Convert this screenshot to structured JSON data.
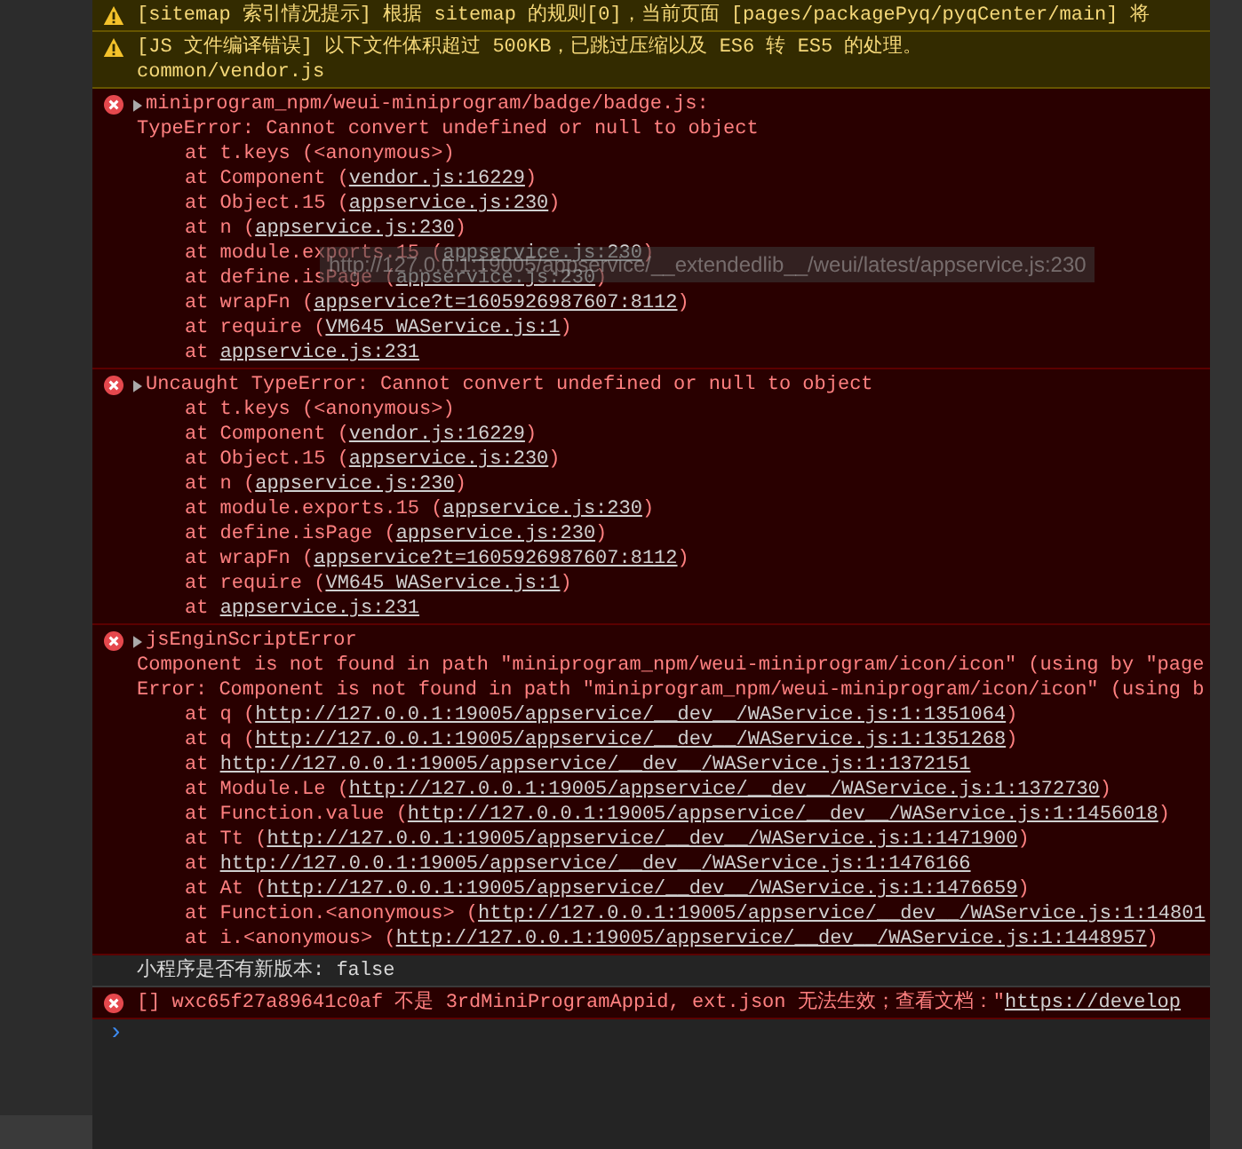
{
  "messages": [
    {
      "kind": "warning",
      "lines": [
        {
          "kind": "text",
          "text": "[sitemap 索引情况提示] 根据 sitemap 的规则[0]，当前页面 [pages/packagePyq/pyqCenter/main] 将"
        }
      ]
    },
    {
      "kind": "warning",
      "lines": [
        {
          "kind": "text",
          "text": "[JS 文件编译错误] 以下文件体积超过 500KB，已跳过压缩以及 ES6 转 ES5 的处理。"
        },
        {
          "kind": "text",
          "text": "common/vendor.js"
        }
      ]
    },
    {
      "kind": "error",
      "expandable": true,
      "lines": [
        {
          "kind": "text",
          "text": "miniprogram_npm/weui-miniprogram/badge/badge.js:"
        },
        {
          "kind": "text",
          "text": "TypeError: Cannot convert undefined or null to object"
        },
        {
          "kind": "frame",
          "text": "at t.keys (<anonymous>)"
        },
        {
          "kind": "frame",
          "text": "at Component (",
          "link": "vendor.js:16229",
          "after": ")"
        },
        {
          "kind": "frame",
          "text": "at Object.15 (",
          "link": "appservice.js:230",
          "after": ")"
        },
        {
          "kind": "frame",
          "text": "at n (",
          "link": "appservice.js:230",
          "after": ")"
        },
        {
          "kind": "frame",
          "text": "at module.exports.15 (",
          "link": "appservice.js:230",
          "after": ")"
        },
        {
          "kind": "frame",
          "text": "at define.isPage (",
          "link": "appservice.js:230",
          "after": ")"
        },
        {
          "kind": "frame",
          "text": "at wrapFn (",
          "link": "appservice?t=1605926987607:8112",
          "after": ")"
        },
        {
          "kind": "frame",
          "text": "at require (",
          "link": "VM645 WAService.js:1",
          "after": ")"
        },
        {
          "kind": "frame",
          "text": "at ",
          "link": "appservice.js:231"
        }
      ]
    },
    {
      "kind": "error",
      "expandable": true,
      "lines": [
        {
          "kind": "text",
          "text": "Uncaught TypeError: Cannot convert undefined or null to object"
        },
        {
          "kind": "frame",
          "text": "at t.keys (<anonymous>)"
        },
        {
          "kind": "frame",
          "text": "at Component (",
          "link": "vendor.js:16229",
          "after": ")"
        },
        {
          "kind": "frame",
          "text": "at Object.15 (",
          "link": "appservice.js:230",
          "after": ")"
        },
        {
          "kind": "frame",
          "text": "at n (",
          "link": "appservice.js:230",
          "after": ")"
        },
        {
          "kind": "frame",
          "text": "at module.exports.15 (",
          "link": "appservice.js:230",
          "after": ")"
        },
        {
          "kind": "frame",
          "text": "at define.isPage (",
          "link": "appservice.js:230",
          "after": ")"
        },
        {
          "kind": "frame",
          "text": "at wrapFn (",
          "link": "appservice?t=1605926987607:8112",
          "after": ")"
        },
        {
          "kind": "frame",
          "text": "at require (",
          "link": "VM645 WAService.js:1",
          "after": ")"
        },
        {
          "kind": "frame",
          "text": "at ",
          "link": "appservice.js:231"
        }
      ]
    },
    {
      "kind": "error",
      "expandable": true,
      "lines": [
        {
          "kind": "text",
          "text": "jsEnginScriptError"
        },
        {
          "kind": "text",
          "text": "Component is not found in path \"miniprogram_npm/weui-miniprogram/icon/icon\" (using by \"page"
        },
        {
          "kind": "text",
          "text": "Error: Component is not found in path \"miniprogram_npm/weui-miniprogram/icon/icon\" (using b"
        },
        {
          "kind": "frame",
          "text": "at q (",
          "link": "http://127.0.0.1:19005/appservice/__dev__/WAService.js:1:1351064",
          "after": ")"
        },
        {
          "kind": "frame",
          "text": "at q (",
          "link": "http://127.0.0.1:19005/appservice/__dev__/WAService.js:1:1351268",
          "after": ")"
        },
        {
          "kind": "frame",
          "text": "at ",
          "link": "http://127.0.0.1:19005/appservice/__dev__/WAService.js:1:1372151"
        },
        {
          "kind": "frame",
          "text": "at Module.Le (",
          "link": "http://127.0.0.1:19005/appservice/__dev__/WAService.js:1:1372730",
          "after": ")"
        },
        {
          "kind": "frame",
          "text": "at Function.value (",
          "link": "http://127.0.0.1:19005/appservice/__dev__/WAService.js:1:1456018",
          "after": ")"
        },
        {
          "kind": "frame",
          "text": "at Tt (",
          "link": "http://127.0.0.1:19005/appservice/__dev__/WAService.js:1:1471900",
          "after": ")"
        },
        {
          "kind": "frame",
          "text": "at ",
          "link": "http://127.0.0.1:19005/appservice/__dev__/WAService.js:1:1476166"
        },
        {
          "kind": "frame",
          "text": "at At (",
          "link": "http://127.0.0.1:19005/appservice/__dev__/WAService.js:1:1476659",
          "after": ")"
        },
        {
          "kind": "frame",
          "text": "at Function.<anonymous> (",
          "link": "http://127.0.0.1:19005/appservice/__dev__/WAService.js:1:14801"
        },
        {
          "kind": "frame",
          "text": "at i.<anonymous> (",
          "link": "http://127.0.0.1:19005/appservice/__dev__/WAService.js:1:1448957",
          "after": ")"
        }
      ]
    },
    {
      "kind": "log",
      "lines": [
        {
          "kind": "text",
          "text": "小程序是否有新版本: false"
        }
      ]
    },
    {
      "kind": "error",
      "expandable": false,
      "lines": [
        {
          "kind": "text",
          "text": "[] wxc65f27a89641c0af 不是 3rdMiniProgramAppid, ext.json 无法生效；查看文档：\"",
          "link": "https://develop"
        }
      ]
    }
  ],
  "tooltip": {
    "text": "http://127.0.0.1:19005/appservice/__extendedlib__/weui/latest/appservice.js:230"
  },
  "prompt": {
    "symbol": "›"
  }
}
